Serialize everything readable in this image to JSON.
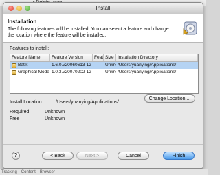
{
  "background": {
    "top_text": "• Delete page",
    "bottom_tabs": [
      "Tracking",
      "Content",
      "Browser"
    ]
  },
  "window": {
    "title": "Install"
  },
  "header": {
    "title": "Installation",
    "description": "The following features will be installed. You can select a feature and change the location where the feature will be installed."
  },
  "features": {
    "label": "Features to install:",
    "columns": [
      "Feature Name",
      "Feature Version",
      "Feat...",
      "Size",
      "Installation Directory"
    ],
    "rows": [
      {
        "name": "Batik",
        "version": "1.6.0.v20060613-12",
        "feat": "",
        "size": "Unknown",
        "dir": "/Users/yuanying/Applications/",
        "selected": true
      },
      {
        "name": "Graphical Mode",
        "version": "1.0.3.v20070202-12",
        "feat": "",
        "size": "Unknown",
        "dir": "/Users/yuanying/Applications/",
        "selected": false
      }
    ]
  },
  "location": {
    "label": "Install Location:",
    "path": "/Users/yuanying/Applications/",
    "change_button": "Change Location ..."
  },
  "space": {
    "required_label": "Required",
    "required_value": "Unknown",
    "free_label": "Free",
    "free_value": "Unknown"
  },
  "buttons": {
    "help": "?",
    "back": "< Back",
    "next": "Next >",
    "cancel": "Cancel",
    "finish": "Finish"
  }
}
